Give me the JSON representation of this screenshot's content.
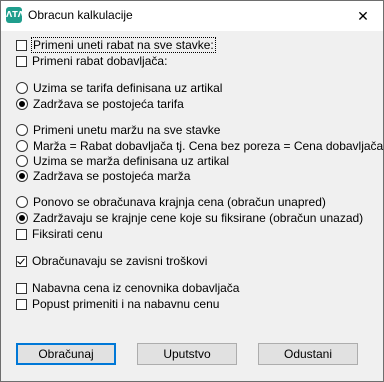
{
  "window": {
    "title": "Obracun kalkulacije",
    "icon_text": "ΛΤΛ",
    "close_glyph": "✕"
  },
  "group1": [
    {
      "label": "Primeni uneti rabat na sve stavke:",
      "checked": false
    },
    {
      "label": "Primeni rabat dobavljača:",
      "checked": false
    }
  ],
  "group2": [
    {
      "label": "Uzima se tarifa definisana uz artikal",
      "selected": false
    },
    {
      "label": "Zadržava se postojeća tarifa",
      "selected": true
    }
  ],
  "group3": [
    {
      "label": "Primeni unetu maržu na sve stavke",
      "selected": false
    },
    {
      "label": "Marža = Rabat dobavljača tj. Cena bez poreza = Cena dobavljača",
      "selected": false
    },
    {
      "label": "Uzima se marža definisana uz artikal",
      "selected": false
    },
    {
      "label": "Zadržava se postojeća marža",
      "selected": true
    }
  ],
  "group4": [
    {
      "label": "Ponovo se obračunava krajnja cena (obračun unapred)",
      "selected": false
    },
    {
      "label": "Zadržavaju se krajnje cene koje su fiksirane (obračun unazad)",
      "selected": true
    }
  ],
  "fiksirati": {
    "label": "Fiksirati cenu",
    "checked": false
  },
  "zavisni": {
    "label": "Obračunavaju se zavisni troškovi",
    "checked": true
  },
  "group5": [
    {
      "label": "Nabavna cena iz cenovnika dobavljača",
      "checked": false
    },
    {
      "label": "Popust primeniti i na nabavnu cenu",
      "checked": false
    }
  ],
  "buttons": {
    "calculate": "Obračunaj",
    "instructions": "Uputstvo",
    "cancel": "Odustani"
  }
}
